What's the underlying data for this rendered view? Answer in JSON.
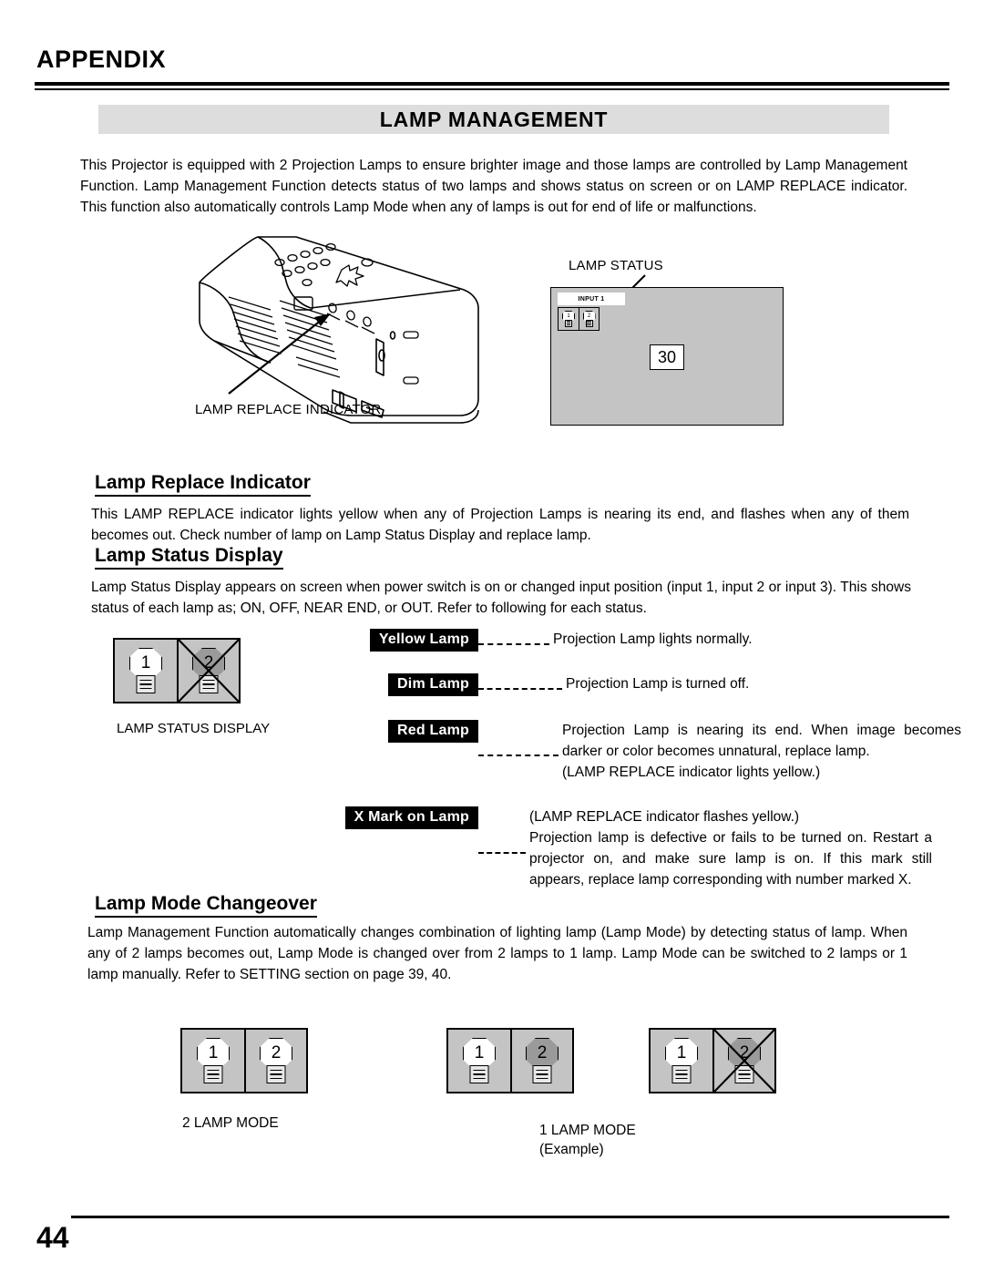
{
  "header": {
    "appendix_label": "APPENDIX",
    "banner_title": "LAMP MANAGEMENT"
  },
  "intro": {
    "text": "This Projector is equipped with 2 Projection Lamps to ensure brighter image and those lamps are controlled by Lamp Management Function.  Lamp Management Function detects status of two lamps and shows status on screen or on LAMP REPLACE indicator.  This function also automatically controls Lamp Mode when any of lamps is out for end of life or malfunctions."
  },
  "figure_projector": {
    "callout_label": "LAMP REPLACE INDICATOR"
  },
  "figure_screen": {
    "callout_label": "LAMP STATUS",
    "input_label": "INPUT 1",
    "count_value": "30",
    "lamp1": "1",
    "lamp2": "2"
  },
  "sections": {
    "replace_indicator": {
      "heading": "Lamp Replace Indicator",
      "text": "This LAMP REPLACE indicator lights yellow when any of Projection Lamps is nearing its end, and flashes when any of them becomes out.  Check number of lamp on Lamp Status Display and replace lamp."
    },
    "status_display": {
      "heading": "Lamp Status Display",
      "text": "Lamp Status Display appears on screen when power switch is on or changed input position (input 1, input 2 or input 3).  This shows status of each lamp as; ON, OFF, NEAR END, or OUT.  Refer to following for each status."
    },
    "mode_changeover": {
      "heading": "Lamp Mode Changeover",
      "text": "Lamp Management Function automatically changes combination of lighting lamp (Lamp Mode) by detecting status of lamp. When any of 2 lamps becomes out, Lamp Mode is changed over from 2 lamps to 1 lamp. Lamp Mode can be switched to 2 lamps or 1 lamp manually.  Refer to SETTING section on page 39, 40."
    }
  },
  "status_figure": {
    "caption": "LAMP STATUS DISPLAY",
    "lamp1": "1",
    "lamp2": "2"
  },
  "legend": {
    "rows": [
      {
        "tag": "Yellow Lamp",
        "lines": [
          "Projection Lamp lights normally."
        ]
      },
      {
        "tag": "Dim Lamp",
        "lines": [
          "Projection Lamp is turned off."
        ]
      },
      {
        "tag": "Red Lamp",
        "lines": [
          "Projection Lamp is nearing its end.  When image becomes darker or color becomes unnatural, replace lamp.",
          "(LAMP REPLACE indicator lights yellow.)"
        ]
      },
      {
        "tag": "X Mark on Lamp",
        "lines": [
          "(LAMP REPLACE indicator flashes yellow.)",
          "Projection lamp is defective or fails to be turned on. Restart a projector on, and make sure lamp is on. If this mark still appears, replace lamp corresponding with number marked X."
        ]
      }
    ]
  },
  "mode_figures": {
    "two_lamp": {
      "lamp1": "1",
      "lamp2": "2",
      "caption": "2 LAMP MODE"
    },
    "one_lamp_a": {
      "lamp1": "1",
      "lamp2": "2"
    },
    "one_lamp_b": {
      "lamp1": "1",
      "lamp2": "2"
    },
    "one_lamp_caption_line1": "1 LAMP MODE",
    "one_lamp_caption_line2": "(Example)"
  },
  "footer": {
    "page_number": "44"
  }
}
